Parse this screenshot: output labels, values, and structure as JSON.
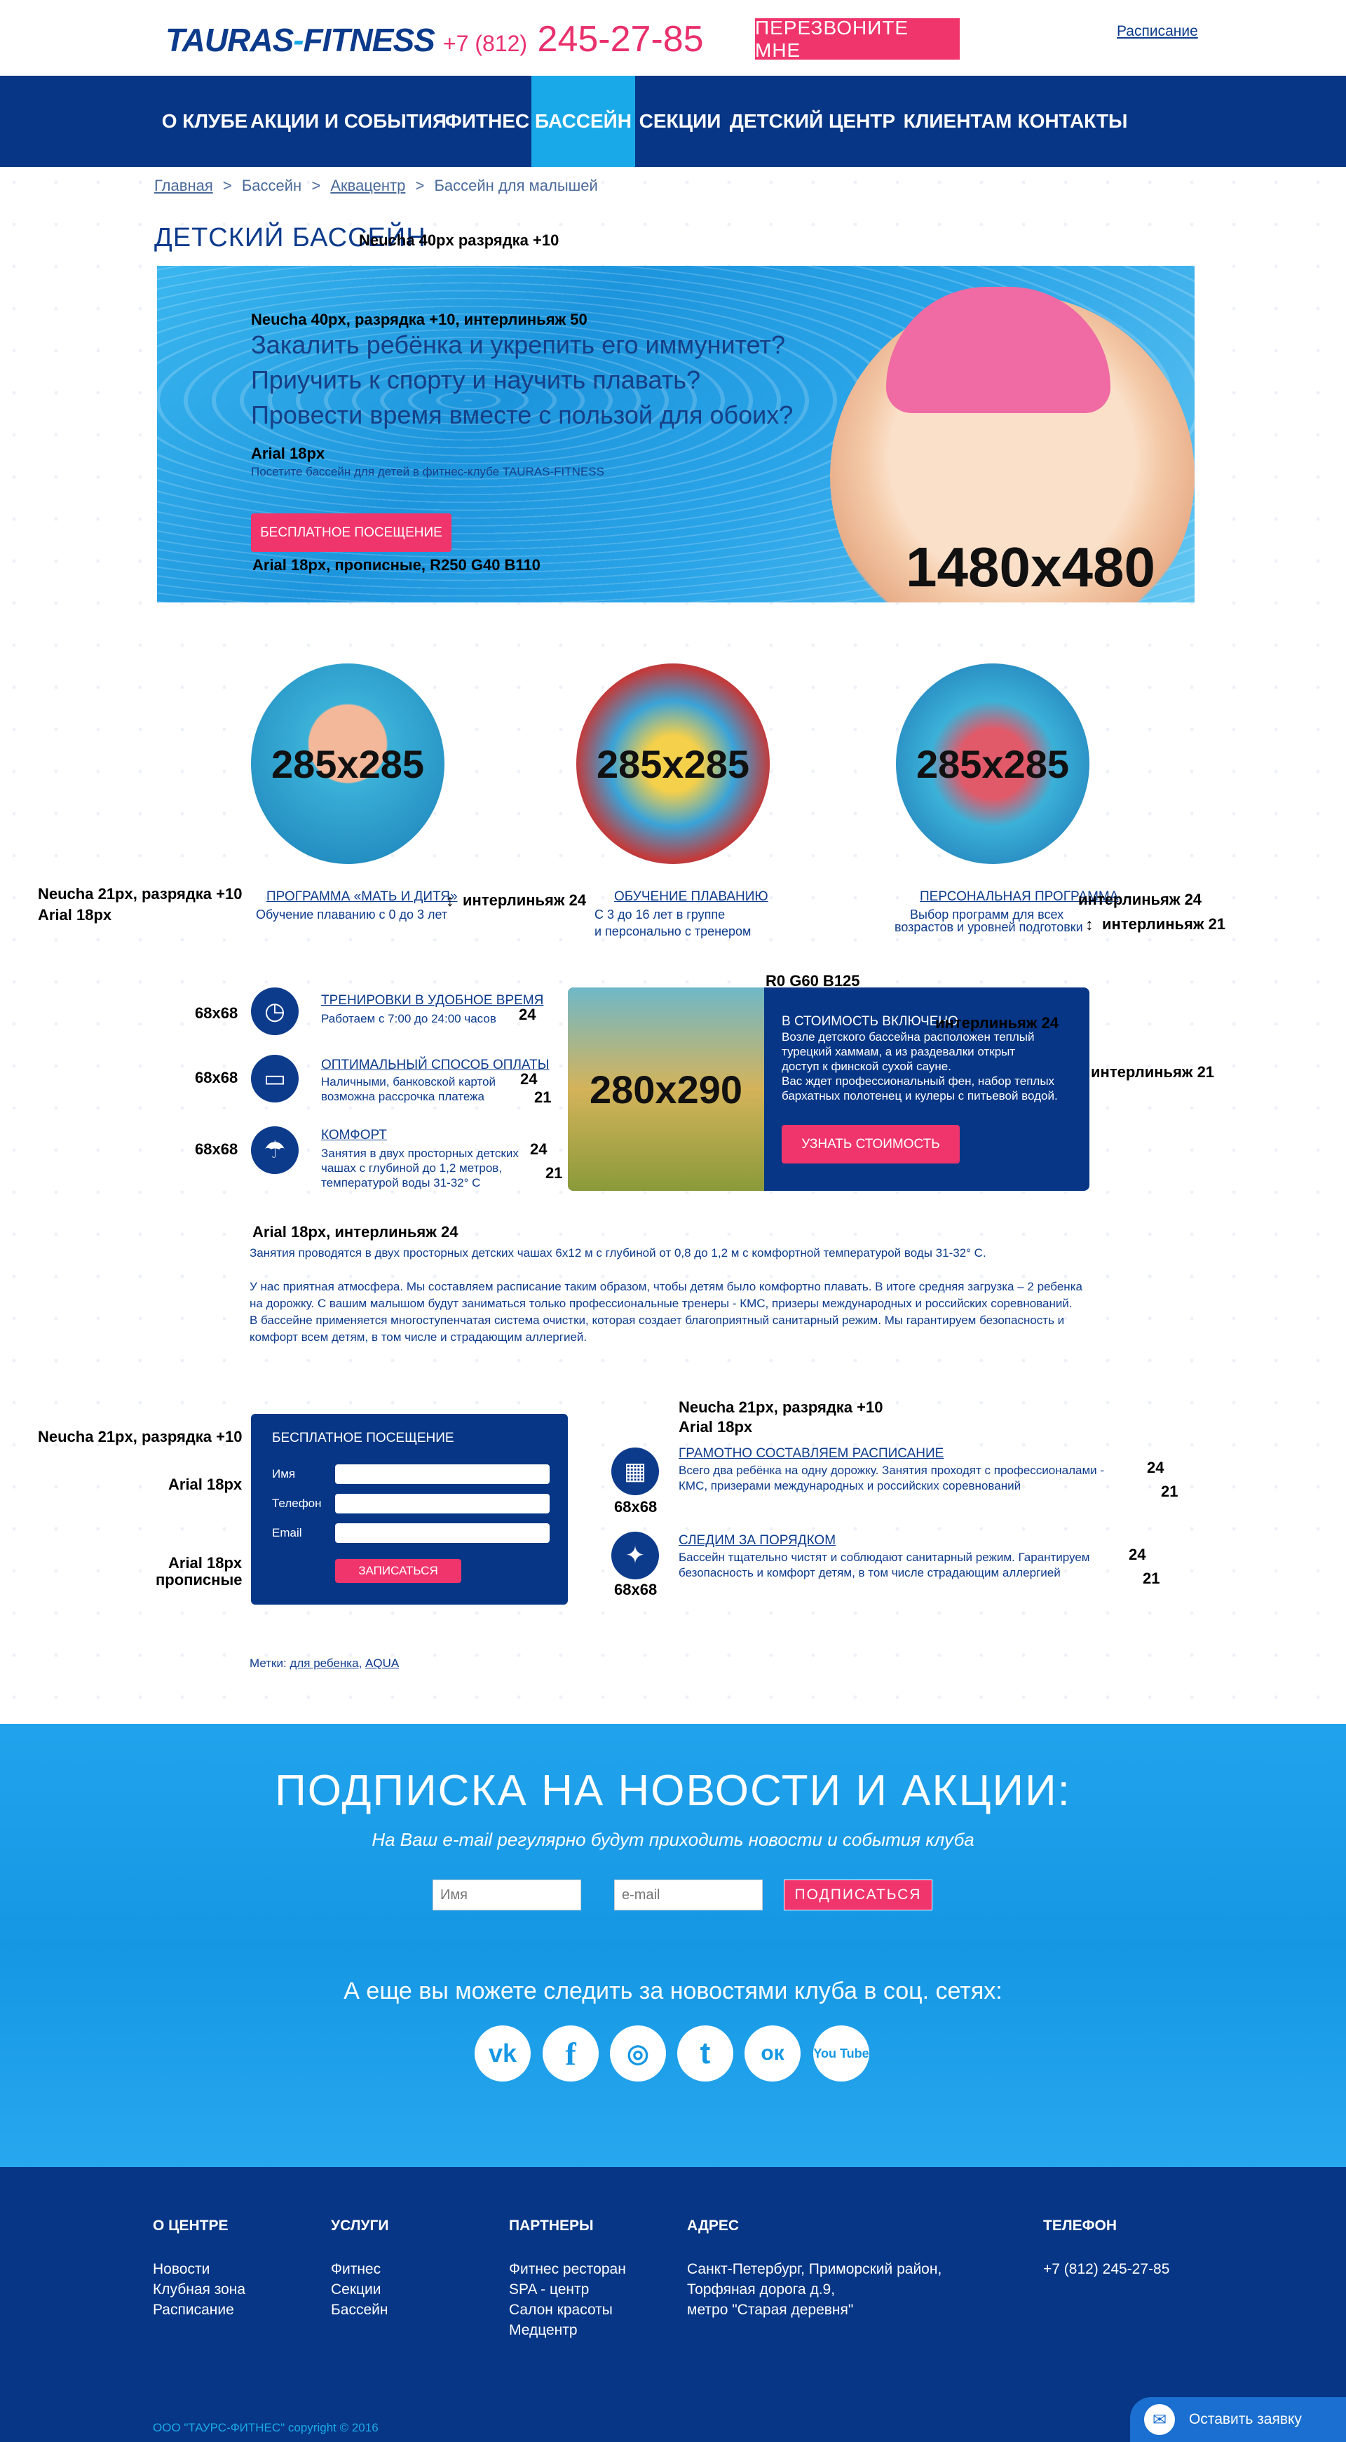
{
  "header": {
    "logo_left": "TAURAS",
    "logo_sep": "-",
    "logo_right": "FITNESS",
    "phone_prefix": "+7 (812)",
    "phone_number": "245-27-85",
    "callback_label": "ПЕРЕЗВОНИТЕ МНЕ",
    "schedule_link": "Расписание"
  },
  "nav": {
    "items": [
      {
        "label": "О КЛУБЕ"
      },
      {
        "label": "АКЦИИ И СОБЫТИЯ"
      },
      {
        "label": "ФИТНЕС"
      },
      {
        "label": "БАССЕЙН"
      },
      {
        "label": "СЕКЦИИ"
      },
      {
        "label": "ДЕТСКИЙ ЦЕНТР"
      },
      {
        "label": "КЛИЕНТАМ"
      },
      {
        "label": "КОНТАКТЫ"
      }
    ],
    "active": "БАССЕЙН"
  },
  "breadcrumbs": [
    "Главная",
    ">",
    "Бассейн",
    ">",
    "Аквацентр",
    ">",
    "Бассейн для малышей"
  ],
  "page_title": "ДЕТСКИЙ БАССЕЙН",
  "notes": {
    "title_font": "Neucha 40px разрядка +10",
    "hero_font": "Neucha 40px, разрядка +10, интерлиньяж 50",
    "hero_sub_font": "Arial 18px",
    "hero_btn_font": "Arial 18px, прописные, R250 G40 B110",
    "hero_dim": "1480x480",
    "circ_font1": "Neucha 21px, разрядка +10",
    "circ_font2": "Arial 18px",
    "interline24": "интерлиньяж 24",
    "interline21": "интерлиньяж 21",
    "circ_dim": "285x285",
    "icon_dim": "68x68",
    "inc_color": "R0 G60 B125",
    "inc_dim": "280x290",
    "n24": "24",
    "n21": "21",
    "body_font": "Arial 18px, интерлиньяж 24",
    "form_font1": "Neucha 21px, разрядка +10",
    "form_font2": "Arial 18px",
    "form_font3a": "Arial 18px",
    "form_font3b": "прописные",
    "right_font1": "Neucha 21px, разрядка +10",
    "right_font2": "Arial 18px"
  },
  "hero": {
    "line1": "Закалить ребёнка и укрепить его иммунитет?",
    "line2": "Приучить к спорту и научить плавать?",
    "line3": "Провести время вместе с пользой для обоих?",
    "subtitle": "Посетите бассейн для детей в фитнес-клубе TAURAS-FITNESS",
    "button": "БЕСПЛАТНОЕ ПОСЕЩЕНИЕ"
  },
  "programs": [
    {
      "title": "ПРОГРАММА «МАТЬ И ДИТЯ»",
      "text1": "Обучение плаванию с 0 до 3 лет",
      "text2": ""
    },
    {
      "title": "ОБУЧЕНИЕ ПЛАВАНИЮ",
      "text1": "С 3 до 16 лет в группе",
      "text2": "и персонально с тренером"
    },
    {
      "title": "ПЕРСОНАЛЬНАЯ ПРОГРАММА",
      "text1": "Выбор программ для всех",
      "text2": "возрастов и уровней подготовки"
    }
  ],
  "features": [
    {
      "title": "ТРЕНИРОВКИ В УДОБНОЕ ВРЕМЯ",
      "text1": "Работаем с 7:00 до 24:00 часов",
      "text2": "",
      "text3": "",
      "icon": "clock-icon"
    },
    {
      "title": "ОПТИМАЛЬНЫЙ СПОСОБ ОПЛАТЫ",
      "text1": "Наличными, банковской картой",
      "text2": "возможна рассрочка платежа",
      "text3": "",
      "icon": "card-icon"
    },
    {
      "title": "КОМФОРТ",
      "text1": "Занятия в двух просторных детских",
      "text2": "чашах с глубиной до 1,2 метров,",
      "text3": "температурой воды 31-32° С",
      "icon": "umbrella-icon"
    }
  ],
  "included": {
    "title": "В СТОИМОСТЬ ВКЛЮЧЕНО",
    "text": "Возле детского бассейна расположен теплый\nтурецкий хаммам, а из раздевалки открыт\nдоступ к финской сухой сауне.\nВас ждет профессиональный фен, набор теплых\nбархатных полотенец и кулеры с питьевой водой.",
    "button": "УЗНАТЬ СТОИМОСТЬ"
  },
  "body": {
    "p1": "Занятия проводятся в двух просторных детских чашах 6х12 м с глубиной от 0,8 до 1,2 м с комфортной температурой воды 31-32° С.",
    "p2": "У нас приятная атмосфера. Мы составляем расписание таким образом, чтобы детям было комфортно плавать. В итоге средняя загрузка – 2 ребенка на дорожку. С вашим малышом будут заниматься только профессиональные тренеры - КМС, призеры международных и российских соревнований.",
    "p3": "В бассейне применяется многоступенчатая система очистки, которая создает благоприятный санитарный режим. Мы гарантируем безопасность и комфорт всем детям, в том числе и страдающим аллергией."
  },
  "form": {
    "title": "БЕСПЛАТНОЕ ПОСЕЩЕНИЕ",
    "name_label": "Имя",
    "phone_label": "Телефон",
    "email_label": "Email",
    "submit": "ЗАПИСАТЬСЯ"
  },
  "advantages": [
    {
      "title": "ГРАМОТНО СОСТАВЛЯЕМ РАСПИСАНИЕ",
      "text1": "Всего два ребёнка на одну дорожку. Занятия проходят с профессионалами -",
      "text2": "КМС, призерами международных и российских соревнований",
      "icon": "schedule-icon"
    },
    {
      "title": "СЛЕДИМ ЗА ПОРЯДКОМ",
      "text1": "Бассейн тщательно чистят и соблюдают санитарный режим. Гарантируем",
      "text2": "безопасность и комфорт детям, в том числе страдающим аллергией",
      "icon": "sparkle-icon"
    }
  ],
  "tags": {
    "label": "Метки:",
    "tag1": "для ребенка",
    "sep": ",",
    "tag2": "AQUA"
  },
  "subscribe": {
    "title": "ПОДПИСКА НА НОВОСТИ И АКЦИИ:",
    "subtitle": "На Ваш e-mail регулярно будут приходить новости и события клуба",
    "name_placeholder": "Имя",
    "email_placeholder": "e-mail",
    "button": "ПОДПИСАТЬСЯ",
    "social_title": "А еще вы можете следить за новостями клуба в соц. сетях:",
    "social": [
      {
        "label": "vk",
        "icon": "vk-icon"
      },
      {
        "label": "f",
        "icon": "facebook-icon"
      },
      {
        "label": "◎",
        "icon": "instagram-icon"
      },
      {
        "label": "t",
        "icon": "twitter-icon"
      },
      {
        "label": "ок",
        "icon": "odnoklassniki-icon"
      },
      {
        "label": "You Tube",
        "icon": "youtube-icon"
      }
    ]
  },
  "footer": {
    "col1": {
      "head": "О ЦЕНТРЕ",
      "items": [
        "Новости",
        "Клубная зона",
        "Расписание"
      ]
    },
    "col2": {
      "head": "УСЛУГИ",
      "items": [
        "Фитнес",
        "Секции",
        "Бассейн"
      ]
    },
    "col3": {
      "head": "ПАРТНЕРЫ",
      "items": [
        "Фитнес ресторан",
        "SPA - центр",
        "Салон красоты",
        "Медцентр"
      ]
    },
    "col4": {
      "head": "АДРЕС",
      "items": [
        "Санкт-Петербург, Приморский район,",
        "Торфяная дорога д.9,",
        "метро \"Старая деревня\""
      ]
    },
    "col5": {
      "head": "ТЕЛЕФОН",
      "items": [
        "+7 (812) 245-27-85"
      ]
    },
    "copyright": "ООО \"ТАУРС-ФИТНЕС\" copyright © 2016",
    "chat": "Оставить заявку"
  },
  "colors": {
    "brand": "#063685",
    "accent": "#f0356c",
    "active": "#1aa9e8",
    "included_bg": "#003c7d"
  }
}
